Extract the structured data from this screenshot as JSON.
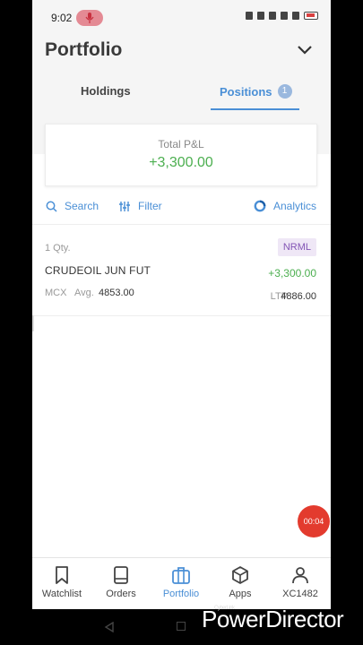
{
  "status_bar": {
    "time": "9:02"
  },
  "header": {
    "title": "Portfolio",
    "tabs": [
      {
        "label": "Holdings",
        "active": false
      },
      {
        "label": "Positions",
        "active": true,
        "badge": "1"
      }
    ]
  },
  "pnl_card": {
    "label": "Total P&L",
    "value": "+3,300.00"
  },
  "toolbar": {
    "search": "Search",
    "filter": "Filter",
    "analytics": "Analytics"
  },
  "positions": [
    {
      "qty": "1 Qty.",
      "product": "NRML",
      "symbol": "CRUDEOIL JUN FUT",
      "pnl": "+3,300.00",
      "exchange": "MCX",
      "avg_label": "Avg.",
      "avg": "4853.00",
      "ltp_label": "LTP",
      "ltp": "4886.00"
    }
  ],
  "recording_timer": "00:04",
  "bottom_nav": [
    {
      "label": "Watchlist",
      "icon": "bookmark-icon"
    },
    {
      "label": "Orders",
      "icon": "book-icon"
    },
    {
      "label": "Portfolio",
      "icon": "briefcase-icon",
      "active": true
    },
    {
      "label": "Apps",
      "icon": "cube-icon"
    },
    {
      "label": "XC1482",
      "icon": "user-icon"
    }
  ],
  "watermark": {
    "brand_small": "CyberLink",
    "brand": "PowerDirector"
  },
  "colors": {
    "accent": "#4a8fd6",
    "profit": "#4caf50",
    "product_badge_bg": "#efe7f6",
    "product_badge_text": "#8355b5",
    "record": "#e33b2e"
  }
}
